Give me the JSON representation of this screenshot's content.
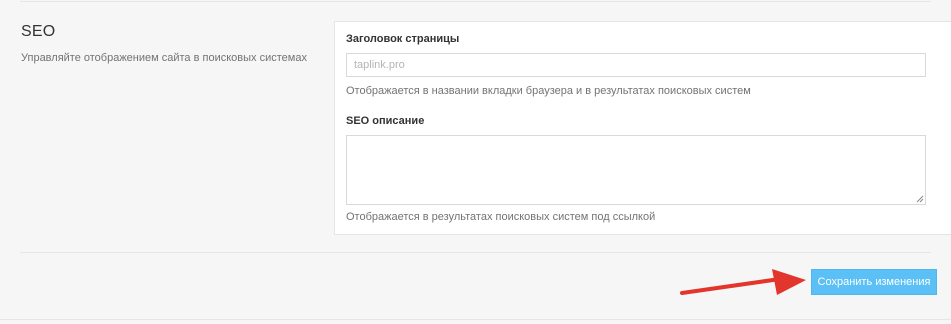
{
  "seo_section": {
    "title": "SEO",
    "description": "Управляйте отображением сайта в поисковых системах"
  },
  "page_title_field": {
    "label": "Заголовок страницы",
    "placeholder": "taplink.pro",
    "value": "",
    "help": "Отображается в названии вкладки браузера и в результатах поисковых систем"
  },
  "seo_description_field": {
    "label": "SEO описание",
    "value": "",
    "help": "Отображается в результатах поисковых систем под ссылкой"
  },
  "actions": {
    "save_label": "Сохранить изменения"
  },
  "annotation": {
    "arrow_icon": "red-arrow-icon",
    "arrow_color": "#e2352c"
  },
  "colors": {
    "background": "#f6f6f6",
    "card": "#ffffff",
    "button": "#5bc0f5"
  }
}
